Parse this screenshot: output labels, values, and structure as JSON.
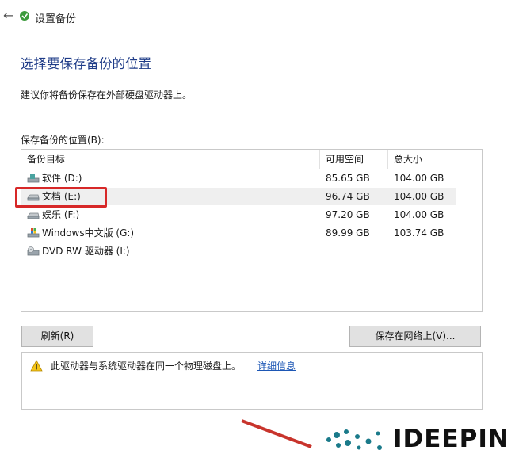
{
  "window": {
    "title": "设置备份"
  },
  "page": {
    "heading": "选择要保存备份的位置",
    "instruction": "建议你将备份保存在外部硬盘驱动器上。",
    "list_label": "保存备份的位置(B):"
  },
  "table": {
    "columns": [
      "备份目标",
      "可用空间",
      "总大小"
    ],
    "rows": [
      {
        "name": "软件 (D:)",
        "free": "85.65 GB",
        "total": "104.00 GB",
        "icon": "drive-share-icon"
      },
      {
        "name": "文档 (E:)",
        "free": "96.74 GB",
        "total": "104.00 GB",
        "icon": "drive-icon",
        "selected": true
      },
      {
        "name": "娱乐 (F:)",
        "free": "97.20 GB",
        "total": "104.00 GB",
        "icon": "drive-icon"
      },
      {
        "name": "Windows中文版 (G:)",
        "free": "89.99 GB",
        "total": "103.74 GB",
        "icon": "windows-drive-icon"
      },
      {
        "name": "DVD RW 驱动器 (I:)",
        "free": "",
        "total": "",
        "icon": "dvd-drive-icon"
      }
    ]
  },
  "buttons": {
    "refresh": "刷新(R)",
    "save_network": "保存在网络上(V)..."
  },
  "info": {
    "warning": "此驱动器与系统驱动器在同一个物理磁盘上。",
    "link": "详细信息"
  },
  "watermark": {
    "text": "IDEEPIN"
  },
  "colors": {
    "heading": "#1f3c88",
    "highlight": "#d72828",
    "link": "#1d57b5",
    "logo_dots": "#1a7a8a"
  }
}
